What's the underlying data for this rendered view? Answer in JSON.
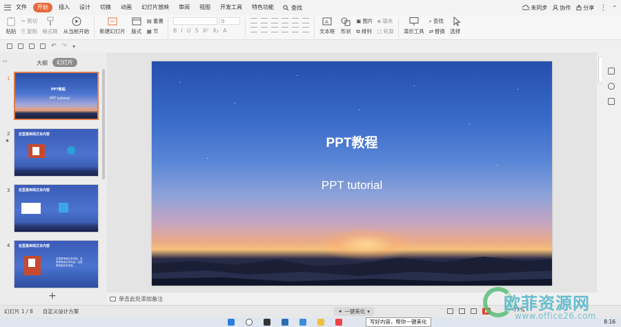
{
  "menubar": {
    "items": [
      {
        "label": "文件",
        "active": false
      },
      {
        "label": "开始",
        "active": true
      },
      {
        "label": "插入",
        "active": false
      },
      {
        "label": "设计",
        "active": false
      },
      {
        "label": "切换",
        "active": false
      },
      {
        "label": "动画",
        "active": false
      },
      {
        "label": "幻灯片放映",
        "active": false
      },
      {
        "label": "审阅",
        "active": false
      },
      {
        "label": "视图",
        "active": false
      },
      {
        "label": "开发工具",
        "active": false
      },
      {
        "label": "特色功能",
        "active": false
      }
    ],
    "search": "查找",
    "sync": "未同步",
    "collab": "协作",
    "share": "分享"
  },
  "ribbon": {
    "paste": "粘贴",
    "cut": "剪切",
    "copy": "复制",
    "format_painter": "格式刷",
    "from_current": "从当前开始",
    "new_slide": "新建幻灯片",
    "layout": "版式",
    "section": "节",
    "reset": "重置",
    "font_size": "0",
    "textbox": "文本框",
    "shape": "形状",
    "picture": "图片",
    "fill": "填充",
    "arrange": "排列",
    "outline": "轮廓",
    "present_tools": "演示工具",
    "find": "查找",
    "replace": "替换",
    "select": "选择"
  },
  "left_panel": {
    "tab_outline": "大纲",
    "tab_slides": "幻灯片",
    "thumbs": [
      {
        "num": "1",
        "title": "PPT教程",
        "sub": "PPT tutorial"
      },
      {
        "num": "2",
        "title": "这里是审阅文本内容"
      },
      {
        "num": "3",
        "title": "这里是审阅文本内容"
      },
      {
        "num": "4",
        "title": "这里是审阅文本内容",
        "body": "这里是审阅文本内容。这里是审阅文本内容。这里是审阅文本内容。"
      }
    ],
    "add": "+"
  },
  "slide": {
    "title": "PPT教程",
    "subtitle": "PPT tutorial"
  },
  "notes": {
    "placeholder": "单击此处添加备注"
  },
  "status": {
    "slide_counter": "幻灯片 1 / 8",
    "theme": "自定义设计方案",
    "beautify": "一键美化",
    "zoom": "77%"
  },
  "taskbar": {
    "tooltip": "写好内容，帮你一键美化",
    "clock": "8:16"
  },
  "watermark": {
    "text": "欧菲资源网",
    "url": "www.office26.com"
  },
  "colors": {
    "accent": "#e56b3a",
    "ribbon_bg": "#f7f7f7"
  }
}
